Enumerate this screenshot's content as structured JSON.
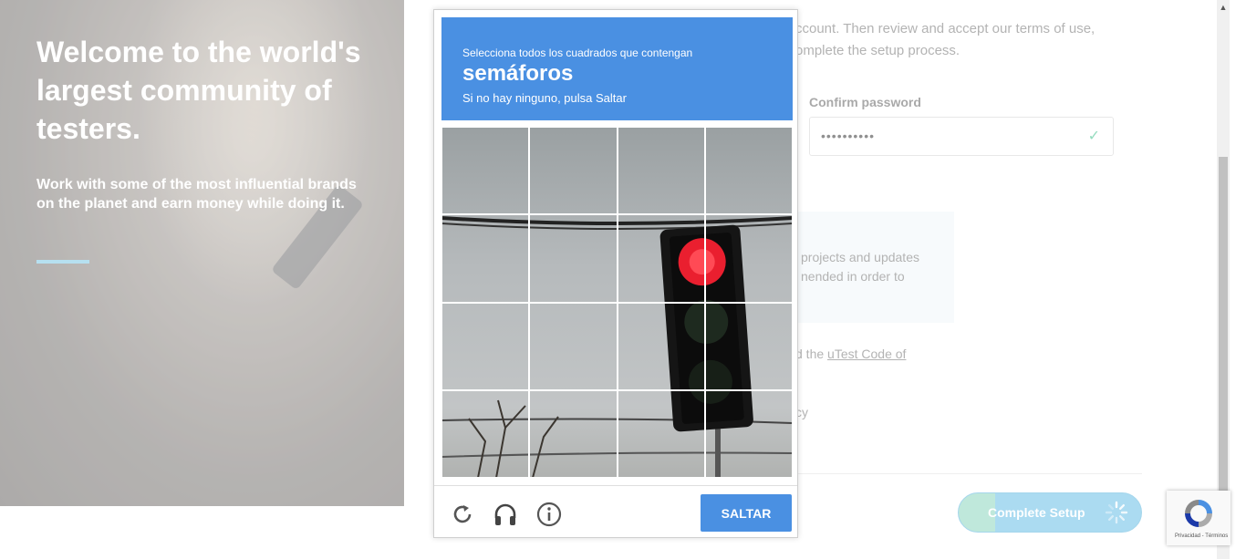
{
  "hero": {
    "heading": "Welcome to the world's largest community of testers.",
    "subtext": "Work with some of the most influential brands on the planet and earn money while doing it."
  },
  "form": {
    "intro_line1": "ccount. Then review and accept our terms of use,",
    "intro_line2": "omplete the setup process.",
    "confirm_password_label": "Confirm password",
    "confirm_password_value": "••••••••••",
    "info_line1": "projects and updates",
    "info_line2": "nended in order to",
    "code_prefix": "d the ",
    "code_link": "uTest Code of",
    "policy_fragment": "cy",
    "complete_button": "Complete Setup"
  },
  "captcha": {
    "instruction": "Selecciona todos los cuadrados que contengan",
    "target": "semáforos",
    "skip_note": "Si no hay ninguno, pulsa Saltar",
    "skip_button": "SALTAR",
    "grid_size": 4,
    "colors": {
      "accent": "#4a90e2",
      "light": "#ea4335"
    }
  },
  "badge": {
    "terms": "Privacidad - Términos"
  }
}
